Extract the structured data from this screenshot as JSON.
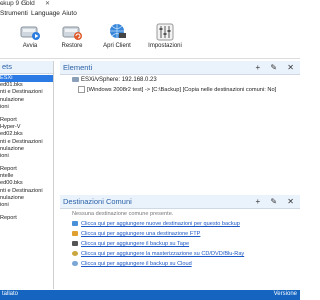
{
  "app_title": "ckup 9 Gold",
  "menu": [
    "Strumenti",
    "Language",
    "Aiuto"
  ],
  "toolbar": [
    {
      "label": "Avvia",
      "icon": "disk-play-icon"
    },
    {
      "label": "Restore",
      "icon": "disk-restore-icon"
    },
    {
      "label": "Apri Client",
      "icon": "network-client-icon"
    },
    {
      "label": "Impostazioni",
      "icon": "settings-sliders-icon"
    }
  ],
  "left": {
    "title": "ets",
    "items": [
      "ESXi",
      "ed01.bks",
      "nti e Destinazioni",
      "nulazione",
      "ioni",
      "",
      "Report",
      "Hyper-V",
      "ed02.bks",
      "nti e Destinazioni",
      "nulazione",
      "ioni",
      "",
      "Report",
      "ntelle",
      "ed00.bks",
      "nti e Destinazioni",
      "nulazione",
      "ioni",
      "",
      "Report"
    ]
  },
  "elementi": {
    "title": "Elementi",
    "buttons": "+ ✎ ✕",
    "server": "ESXi/vSphere: 192.168.0.23",
    "item": "[Windows 2008r2 test]  ->  [C:\\Backup]  [Copia nelle destinazioni comuni: No]"
  },
  "destinazioni": {
    "title": "Destinazioni Comuni",
    "buttons": "+ ✎ ✕",
    "empty": "Nessuna destinazione comune presente.",
    "links": [
      {
        "text": "Clicca qui per aggiungere nuove destinazioni per questo backup",
        "color": "#4a90d9"
      },
      {
        "text": "Clicca qui per aggiungere una destinazione FTP",
        "color": "#e0a030"
      },
      {
        "text": "Clicca qui per aggiungere il backup su Tape",
        "color": "#555555"
      },
      {
        "text": "Clicca qui per aggiungere la masterizzazione su CD/DVD/Blu-Ray",
        "color": "#c9a640"
      },
      {
        "text": "Clicca qui per aggiungere il backup su Cloud",
        "color": "#7aa7d6"
      }
    ]
  },
  "status": {
    "left": "tallato",
    "right": "Versione"
  }
}
